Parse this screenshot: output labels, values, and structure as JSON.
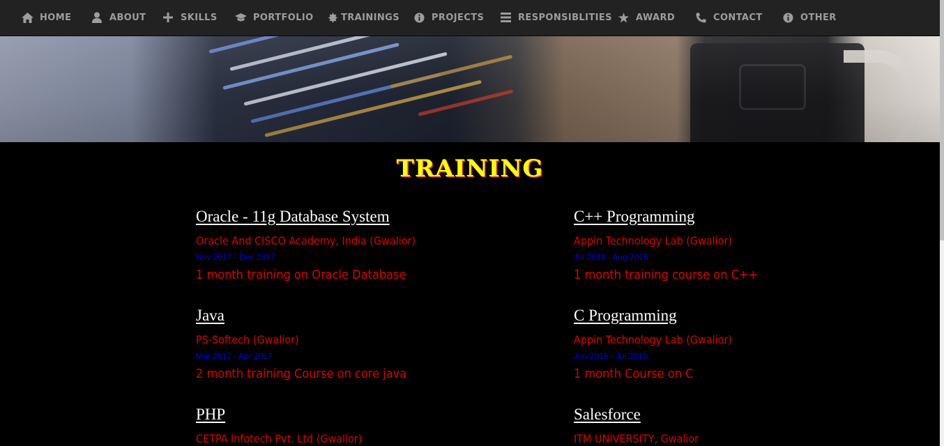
{
  "nav": {
    "items": [
      {
        "label": "HOME",
        "icon": "home-icon"
      },
      {
        "label": "ABOUT",
        "icon": "user-icon"
      },
      {
        "label": "SKILLS",
        "icon": "plus-icon"
      },
      {
        "label": "PORTFOLIO",
        "icon": "graduation-cap-icon"
      },
      {
        "label": "TRAININGS",
        "icon": "certificate-icon"
      },
      {
        "label": "PROJECTS",
        "icon": "info-icon"
      },
      {
        "label": "RESPONSIBLITIES",
        "icon": "list-icon"
      },
      {
        "label": "AWARD",
        "icon": "star-icon"
      },
      {
        "label": "CONTACT",
        "icon": "phone-icon"
      },
      {
        "label": "OTHER",
        "icon": "info-icon"
      }
    ]
  },
  "training": {
    "title": "TRAINING",
    "courses": [
      {
        "title": "Oracle - 11g Database System",
        "org": "Oracle And CISCO Academy, India (Gwalior)",
        "dates": "Nov 2017 - Dec 2017",
        "desc": "1 month training on Oracle Database"
      },
      {
        "title": "C++ Programming",
        "org": "Appin Technology Lab (Gwalior)",
        "dates": "Jul 2016 - Aug 2016",
        "desc": "1 month training course on C++"
      },
      {
        "title": "Java",
        "org": "PS-Softech (Gwalior)",
        "dates": "Mar 2017 - Apr 2017",
        "desc": "2 month training Course on core java"
      },
      {
        "title": "C Programming",
        "org": "Appin Technology Lab (Gwalior)",
        "dates": "Jun 2016 - Jul 2016",
        "desc": "1 month Course on C"
      },
      {
        "title": "PHP",
        "org": "CETPA Infotech Pvt. Ltd (Gwalior)",
        "dates": "",
        "desc": ""
      },
      {
        "title": "Salesforce",
        "org": "ITM UNIVERSITY, Gwalior",
        "dates": "",
        "desc": ""
      }
    ]
  },
  "colors": {
    "nav_bg": "#222222",
    "nav_text": "#9d9d9d",
    "title_yellow": "#ffff00",
    "course_title": "#ffffff",
    "org_red": "#e00000",
    "dates_blue": "#0000ee"
  }
}
